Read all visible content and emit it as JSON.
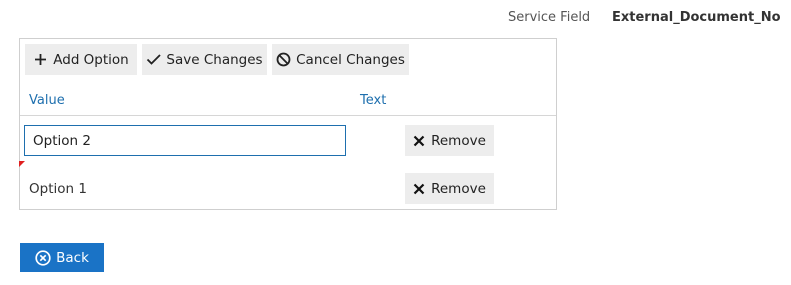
{
  "header": {
    "label": "Service Field",
    "value": "External_Document_No"
  },
  "toolbar": {
    "add_label": "Add Option",
    "save_label": "Save Changes",
    "cancel_label": "Cancel Changes"
  },
  "table": {
    "columns": [
      "Value",
      "Text"
    ],
    "rows": [
      {
        "value": "Option 2",
        "editing": true,
        "remove_label": "Remove"
      },
      {
        "value": "Option 1",
        "editing": false,
        "remove_label": "Remove"
      }
    ]
  },
  "footer": {
    "back_label": "Back"
  },
  "colors": {
    "accent": "#1a73c6",
    "column_header": "#1e6fae",
    "dirty_marker": "#e02020",
    "button_bg": "#ededed"
  },
  "icons": {
    "add": "plus-icon",
    "save": "check-icon",
    "cancel": "ban-icon",
    "remove": "x-icon",
    "back": "circle-x-icon"
  }
}
